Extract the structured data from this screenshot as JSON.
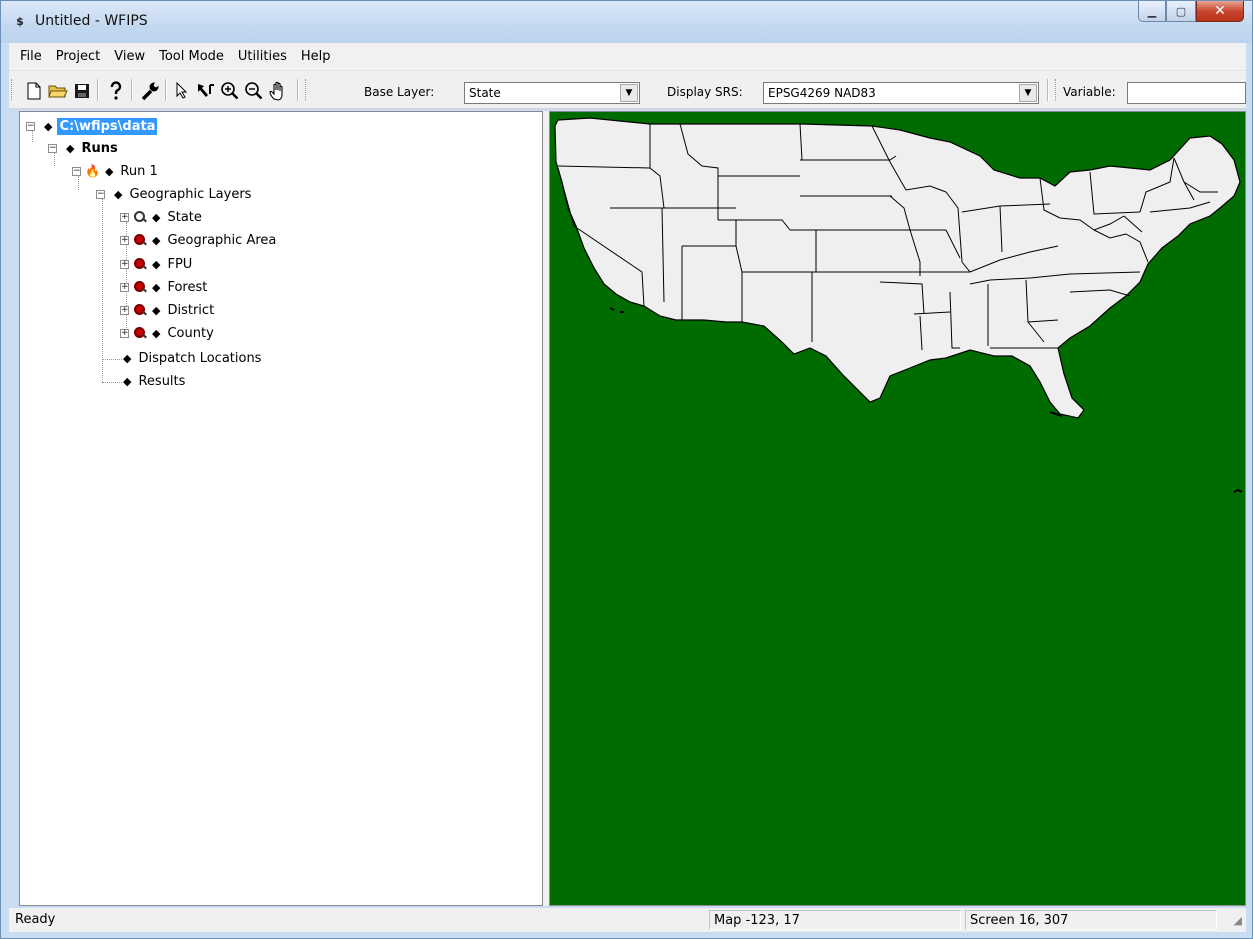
{
  "window": {
    "title": "Untitled - WFIPS",
    "app_icon": "wfips-app-icon",
    "controls": [
      "minimize",
      "maximize",
      "close"
    ]
  },
  "menu": [
    {
      "label": "File"
    },
    {
      "label": "Project"
    },
    {
      "label": "View"
    },
    {
      "label": "Tool Mode"
    },
    {
      "label": "Utilities"
    },
    {
      "label": "Help"
    }
  ],
  "toolbar": {
    "icons": [
      "new-document-icon",
      "open-folder-icon",
      "save-icon",
      "help-icon",
      "wrench-icon",
      "select-arrow-icon",
      "identify-arrow-icon",
      "zoom-in-icon",
      "zoom-out-icon",
      "pan-hand-icon"
    ],
    "base_layer_label": "Base Layer:",
    "base_layer_value": "State",
    "display_srs_label": "Display SRS:",
    "display_srs_value": "EPSG4269 NAD83",
    "variable_label": "Variable:",
    "variable_value": ""
  },
  "tree": {
    "root": "C:\\wfips\\data",
    "runs": "Runs",
    "run1": "Run 1",
    "geographic_layers": "Geographic Layers",
    "layers": [
      "State",
      "Geographic Area",
      "FPU",
      "Forest",
      "District",
      "County"
    ],
    "dispatch_locations": "Dispatch Locations",
    "results": "Results"
  },
  "map": {
    "background_color": "#006c00",
    "land_color": "#efefef",
    "border_color": "#000000"
  },
  "status": {
    "message": "Ready",
    "map_coords": "Map -123, 17",
    "screen_coords": "Screen 16, 307"
  }
}
